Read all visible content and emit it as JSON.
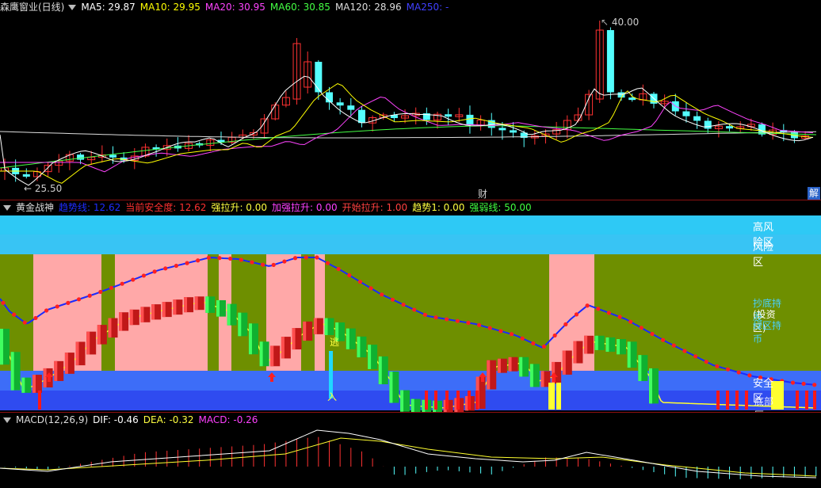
{
  "colors": {
    "up": "#ff3232",
    "down": "#54ffff",
    "ma5": "#ffffff",
    "ma10": "#ffff00",
    "ma20": "#ff44ff",
    "ma60": "#44ff44",
    "ma120": "#dddddd",
    "ma250": "#4040ff",
    "risk_high": "#2ec9f5",
    "risk": "#38c4f4",
    "pink": "#ffa8a8",
    "olive": "#6e8f00",
    "safe": "#3d6df8",
    "safe2": "#2f4bf0"
  },
  "price_panel": {
    "title": "森鹰窗业(日线)",
    "ma": [
      {
        "label": "MA5: 29.87",
        "color": "#ffffff"
      },
      {
        "label": "MA10: 29.95",
        "color": "#ffff00"
      },
      {
        "label": "MA20: 30.95",
        "color": "#ff44ff"
      },
      {
        "label": "MA60: 30.85",
        "color": "#44ff44"
      },
      {
        "label": "MA120: 28.96",
        "color": "#dddddd"
      },
      {
        "label": "MA250: -",
        "color": "#4040ff"
      }
    ],
    "high_label": "40.00",
    "low_label": "25.50",
    "event_cai": "财",
    "event_jie": "解"
  },
  "gold_panel": {
    "title": "黄金战神",
    "indicators": [
      {
        "label": "趋势线: 12.62",
        "color": "#1e2cff"
      },
      {
        "label": "当前安全度: 12.62",
        "color": "#ff3030"
      },
      {
        "label": "强拉升: 0.00",
        "color": "#ffff40"
      },
      {
        "label": "加强拉升: 0.00",
        "color": "#ff40ff"
      },
      {
        "label": "开始拉升: 1.00",
        "color": "#ff4040"
      },
      {
        "label": "趋势1: 0.00",
        "color": "#ffff40"
      },
      {
        "label": "强弱线: 50.00",
        "color": "#40ff40"
      }
    ],
    "zones": {
      "high_risk": "高风险区",
      "risk": "风险区",
      "bottom_a": "抄底持股",
      "bottom_b": "(投资区)",
      "bottom_c": "绿区持币",
      "safe": "安全区",
      "low": "底部区"
    },
    "escape_label": "逃",
    "enter_label": "入"
  },
  "macd_panel": {
    "title": "MACD(12,26,9)",
    "dif": "DIF: -0.46",
    "dea": "DEA: -0.32",
    "macd": "MACD: -0.26"
  }
}
